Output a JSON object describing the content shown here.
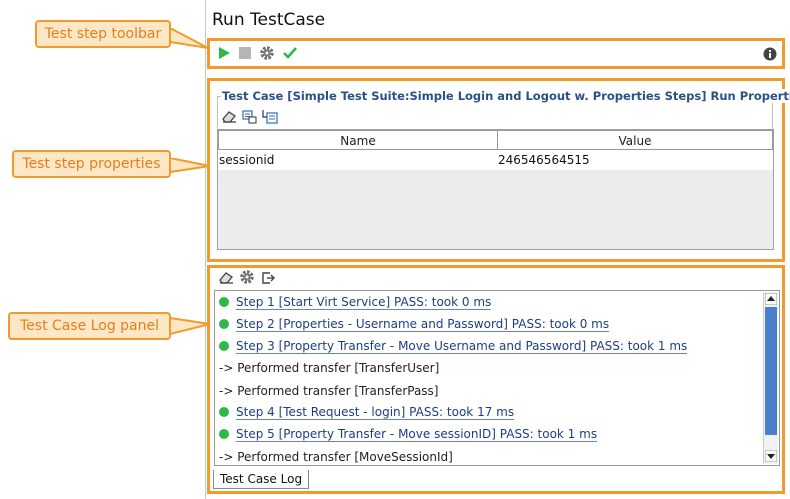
{
  "window": {
    "title": "Run TestCase"
  },
  "callouts": {
    "toolbar": "Test step toolbar",
    "properties": "Test step properties",
    "log": "Test Case Log panel"
  },
  "toolbar": {
    "icons": [
      "play-icon",
      "stop-icon",
      "gear-icon",
      "check-icon",
      "info-icon"
    ]
  },
  "properties": {
    "group_title": "Test Case [Simple Test Suite:Simple Login and Logout w. Properties Steps] Run Properties",
    "columns": [
      "Name",
      "Value"
    ],
    "rows": [
      {
        "name": "sessionid",
        "value": "246546564515"
      }
    ]
  },
  "log": {
    "lines": [
      {
        "type": "step",
        "text": "Step 1 [Start Virt Service] PASS: took 0 ms"
      },
      {
        "type": "step",
        "text": "Step 2 [Properties - Username and Password] PASS: took 0 ms"
      },
      {
        "type": "step",
        "text": "Step 3 [Property Transfer - Move Username and Password] PASS: took 1 ms"
      },
      {
        "type": "text",
        "text": "-> Performed transfer [TransferUser]"
      },
      {
        "type": "text",
        "text": "-> Performed transfer [TransferPass]"
      },
      {
        "type": "step",
        "text": "Step 4 [Test Request - login] PASS: took 17 ms"
      },
      {
        "type": "step",
        "text": "Step 5 [Property Transfer - Move sessionID] PASS: took 1 ms"
      },
      {
        "type": "text",
        "text": "-> Performed transfer [MoveSessionId]"
      }
    ],
    "tab_label": "Test Case Log"
  },
  "colors": {
    "accent": "#f39a2e",
    "pass": "#2fb84a",
    "link": "#1f3d85"
  }
}
